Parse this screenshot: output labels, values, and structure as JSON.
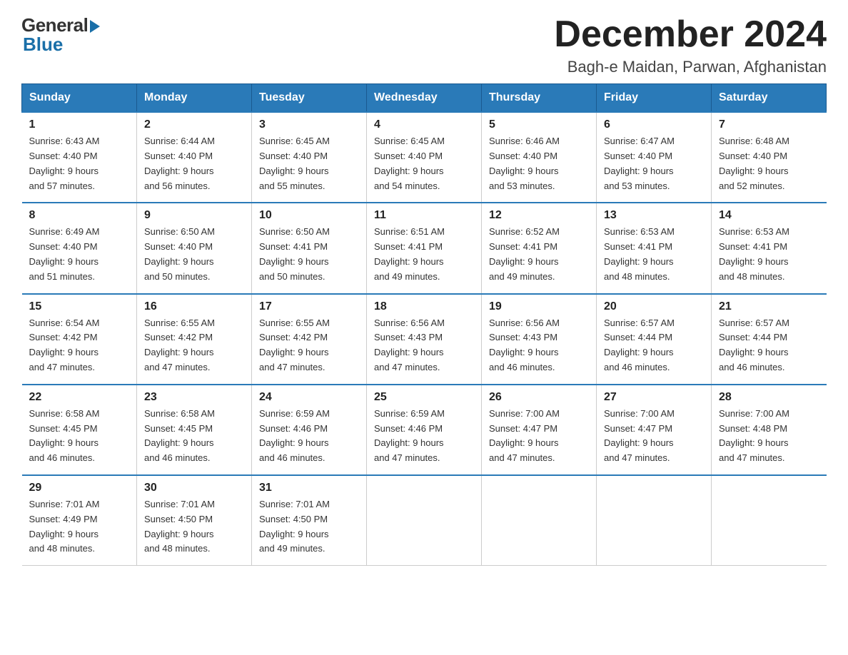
{
  "logo": {
    "general": "General",
    "blue": "Blue"
  },
  "header": {
    "title": "December 2024",
    "location": "Bagh-e Maidan, Parwan, Afghanistan"
  },
  "weekdays": [
    "Sunday",
    "Monday",
    "Tuesday",
    "Wednesday",
    "Thursday",
    "Friday",
    "Saturday"
  ],
  "weeks": [
    [
      {
        "day": "1",
        "info": "Sunrise: 6:43 AM\nSunset: 4:40 PM\nDaylight: 9 hours\nand 57 minutes."
      },
      {
        "day": "2",
        "info": "Sunrise: 6:44 AM\nSunset: 4:40 PM\nDaylight: 9 hours\nand 56 minutes."
      },
      {
        "day": "3",
        "info": "Sunrise: 6:45 AM\nSunset: 4:40 PM\nDaylight: 9 hours\nand 55 minutes."
      },
      {
        "day": "4",
        "info": "Sunrise: 6:45 AM\nSunset: 4:40 PM\nDaylight: 9 hours\nand 54 minutes."
      },
      {
        "day": "5",
        "info": "Sunrise: 6:46 AM\nSunset: 4:40 PM\nDaylight: 9 hours\nand 53 minutes."
      },
      {
        "day": "6",
        "info": "Sunrise: 6:47 AM\nSunset: 4:40 PM\nDaylight: 9 hours\nand 53 minutes."
      },
      {
        "day": "7",
        "info": "Sunrise: 6:48 AM\nSunset: 4:40 PM\nDaylight: 9 hours\nand 52 minutes."
      }
    ],
    [
      {
        "day": "8",
        "info": "Sunrise: 6:49 AM\nSunset: 4:40 PM\nDaylight: 9 hours\nand 51 minutes."
      },
      {
        "day": "9",
        "info": "Sunrise: 6:50 AM\nSunset: 4:40 PM\nDaylight: 9 hours\nand 50 minutes."
      },
      {
        "day": "10",
        "info": "Sunrise: 6:50 AM\nSunset: 4:41 PM\nDaylight: 9 hours\nand 50 minutes."
      },
      {
        "day": "11",
        "info": "Sunrise: 6:51 AM\nSunset: 4:41 PM\nDaylight: 9 hours\nand 49 minutes."
      },
      {
        "day": "12",
        "info": "Sunrise: 6:52 AM\nSunset: 4:41 PM\nDaylight: 9 hours\nand 49 minutes."
      },
      {
        "day": "13",
        "info": "Sunrise: 6:53 AM\nSunset: 4:41 PM\nDaylight: 9 hours\nand 48 minutes."
      },
      {
        "day": "14",
        "info": "Sunrise: 6:53 AM\nSunset: 4:41 PM\nDaylight: 9 hours\nand 48 minutes."
      }
    ],
    [
      {
        "day": "15",
        "info": "Sunrise: 6:54 AM\nSunset: 4:42 PM\nDaylight: 9 hours\nand 47 minutes."
      },
      {
        "day": "16",
        "info": "Sunrise: 6:55 AM\nSunset: 4:42 PM\nDaylight: 9 hours\nand 47 minutes."
      },
      {
        "day": "17",
        "info": "Sunrise: 6:55 AM\nSunset: 4:42 PM\nDaylight: 9 hours\nand 47 minutes."
      },
      {
        "day": "18",
        "info": "Sunrise: 6:56 AM\nSunset: 4:43 PM\nDaylight: 9 hours\nand 47 minutes."
      },
      {
        "day": "19",
        "info": "Sunrise: 6:56 AM\nSunset: 4:43 PM\nDaylight: 9 hours\nand 46 minutes."
      },
      {
        "day": "20",
        "info": "Sunrise: 6:57 AM\nSunset: 4:44 PM\nDaylight: 9 hours\nand 46 minutes."
      },
      {
        "day": "21",
        "info": "Sunrise: 6:57 AM\nSunset: 4:44 PM\nDaylight: 9 hours\nand 46 minutes."
      }
    ],
    [
      {
        "day": "22",
        "info": "Sunrise: 6:58 AM\nSunset: 4:45 PM\nDaylight: 9 hours\nand 46 minutes."
      },
      {
        "day": "23",
        "info": "Sunrise: 6:58 AM\nSunset: 4:45 PM\nDaylight: 9 hours\nand 46 minutes."
      },
      {
        "day": "24",
        "info": "Sunrise: 6:59 AM\nSunset: 4:46 PM\nDaylight: 9 hours\nand 46 minutes."
      },
      {
        "day": "25",
        "info": "Sunrise: 6:59 AM\nSunset: 4:46 PM\nDaylight: 9 hours\nand 47 minutes."
      },
      {
        "day": "26",
        "info": "Sunrise: 7:00 AM\nSunset: 4:47 PM\nDaylight: 9 hours\nand 47 minutes."
      },
      {
        "day": "27",
        "info": "Sunrise: 7:00 AM\nSunset: 4:47 PM\nDaylight: 9 hours\nand 47 minutes."
      },
      {
        "day": "28",
        "info": "Sunrise: 7:00 AM\nSunset: 4:48 PM\nDaylight: 9 hours\nand 47 minutes."
      }
    ],
    [
      {
        "day": "29",
        "info": "Sunrise: 7:01 AM\nSunset: 4:49 PM\nDaylight: 9 hours\nand 48 minutes."
      },
      {
        "day": "30",
        "info": "Sunrise: 7:01 AM\nSunset: 4:50 PM\nDaylight: 9 hours\nand 48 minutes."
      },
      {
        "day": "31",
        "info": "Sunrise: 7:01 AM\nSunset: 4:50 PM\nDaylight: 9 hours\nand 49 minutes."
      },
      {
        "day": "",
        "info": ""
      },
      {
        "day": "",
        "info": ""
      },
      {
        "day": "",
        "info": ""
      },
      {
        "day": "",
        "info": ""
      }
    ]
  ]
}
